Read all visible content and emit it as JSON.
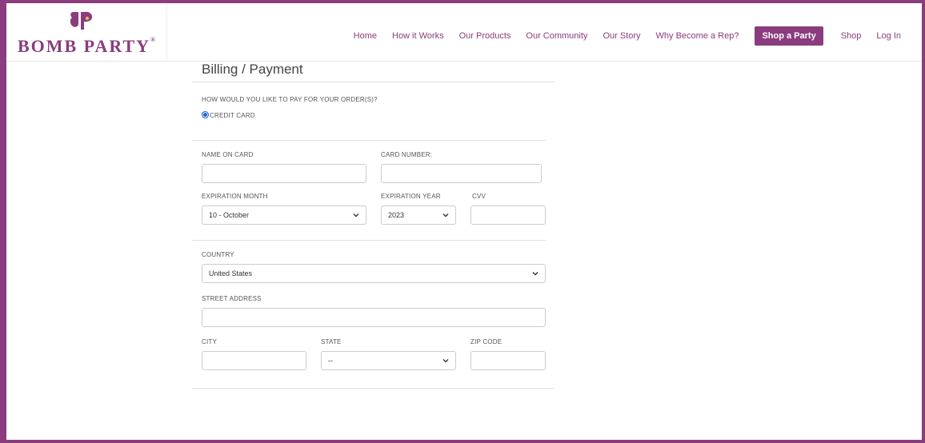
{
  "brand": {
    "name": "BOMB PARTY",
    "trademark": "®",
    "color": "#8a3c7e"
  },
  "nav": {
    "items": [
      "Home",
      "How it Works",
      "Our Products",
      "Our Community",
      "Our Story",
      "Why Become a Rep?"
    ],
    "cta": "Shop a Party",
    "shop": "Shop",
    "login": "Log In"
  },
  "page": {
    "title": "Billing / Payment"
  },
  "payment": {
    "question": "HOW WOULD YOU LIKE TO PAY FOR YOUR ORDER(S)?",
    "option_label": "CREDIT CARD",
    "option_selected": true
  },
  "card": {
    "name_label": "NAME ON CARD",
    "name_value": "",
    "number_label": "CARD NUMBER:",
    "number_value": "",
    "exp_month_label": "EXPIRATION MONTH",
    "exp_month_value": "10 - October",
    "exp_year_label": "EXPIRATION YEAR",
    "exp_year_value": "2023",
    "cvv_label": "CVV",
    "cvv_value": ""
  },
  "address": {
    "country_label": "COUNTRY",
    "country_value": "United States",
    "street_label": "STREET ADDRESS",
    "street_value": "",
    "city_label": "CITY",
    "city_value": "",
    "state_label": "STATE",
    "state_value": "--",
    "zip_label": "ZIP CODE",
    "zip_value": ""
  }
}
